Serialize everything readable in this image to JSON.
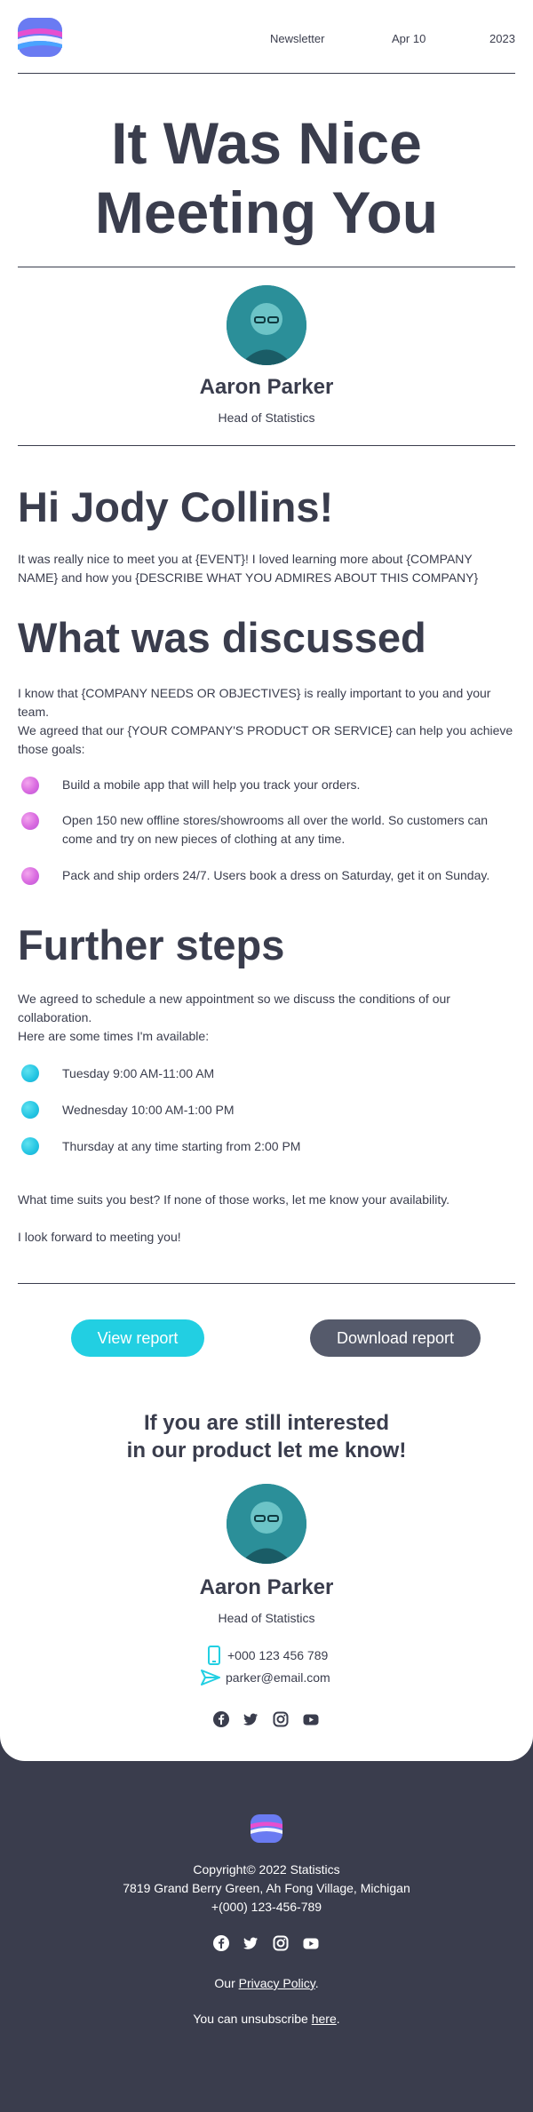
{
  "header": {
    "newsletter": "Newsletter",
    "date": "Apr 10",
    "year": "2023"
  },
  "hero": {
    "title_line1": "It Was Nice",
    "title_line2": "Meeting You"
  },
  "author": {
    "name": "Aaron Parker",
    "role": "Head of Statistics"
  },
  "greeting": "Hi Jody Collins!",
  "intro_line1": "It was really nice to meet you at {EVENT}! I loved learning more about {COMPANY",
  "intro_line2": "NAME} and how you {DESCRIBE WHAT YOU ADMIRES ABOUT THIS COMPANY}",
  "discussed": {
    "title": "What was discussed",
    "line1": "I know that {COMPANY NEEDS OR OBJECTIVES} is really important to you and your",
    "line2": "team.",
    "line3": "We agreed that our {YOUR COMPANY'S PRODUCT OR SERVICE} can help you achieve",
    "line4": "those goals:",
    "goals": [
      {
        "line1": "Build a mobile app that will help you track your orders.",
        "line2": ""
      },
      {
        "line1": "Open 150 new offline stores/showrooms all over the world. So customers can",
        "line2": "come and try on new pieces of clothing at any time."
      },
      {
        "line1": "Pack and ship orders 24/7. Users book a dress on Saturday, get it on Sunday.",
        "line2": ""
      }
    ]
  },
  "further": {
    "title": "Further steps",
    "line1": "We agreed to schedule a new appointment so we discuss the conditions of our",
    "line2": "collaboration.",
    "line3": "Here are some times I'm available:",
    "times": [
      "Tuesday 9:00 AM-11:00 AM",
      "Wednesday 10:00 AM-1:00 PM",
      "Thursday at any time starting from 2:00 PM"
    ],
    "question": "What time suits you best? If none of those works, let me know your availability.",
    "closing": "I look forward to meeting you!"
  },
  "buttons": {
    "view": "View report",
    "download": "Download report"
  },
  "cta": {
    "line1": "If you are still interested",
    "line2": "in our product let me know!"
  },
  "contact": {
    "phone": "+000 123 456 789",
    "email": "parker@email.com"
  },
  "footer": {
    "copyright": "Copyright© 2022 Statistics",
    "address": "7819 Grand Berry Green, Ah Fong Village, Michigan",
    "phone": "+(000) 123-456-789",
    "privacy_prefix": "Our ",
    "privacy_link": "Privacy Policy",
    "privacy_suffix": ".",
    "unsub_prefix": "You can unsubscribe ",
    "unsub_link": "here",
    "unsub_suffix": "."
  },
  "colors": {
    "dark": "#3a3d4d",
    "cyan": "#22cfe2",
    "gray_button": "#555a6b",
    "pink": "#d96ae0"
  },
  "icons": [
    "logo-icon",
    "phone-icon",
    "send-icon",
    "facebook-icon",
    "twitter-icon",
    "instagram-icon",
    "youtube-icon"
  ]
}
